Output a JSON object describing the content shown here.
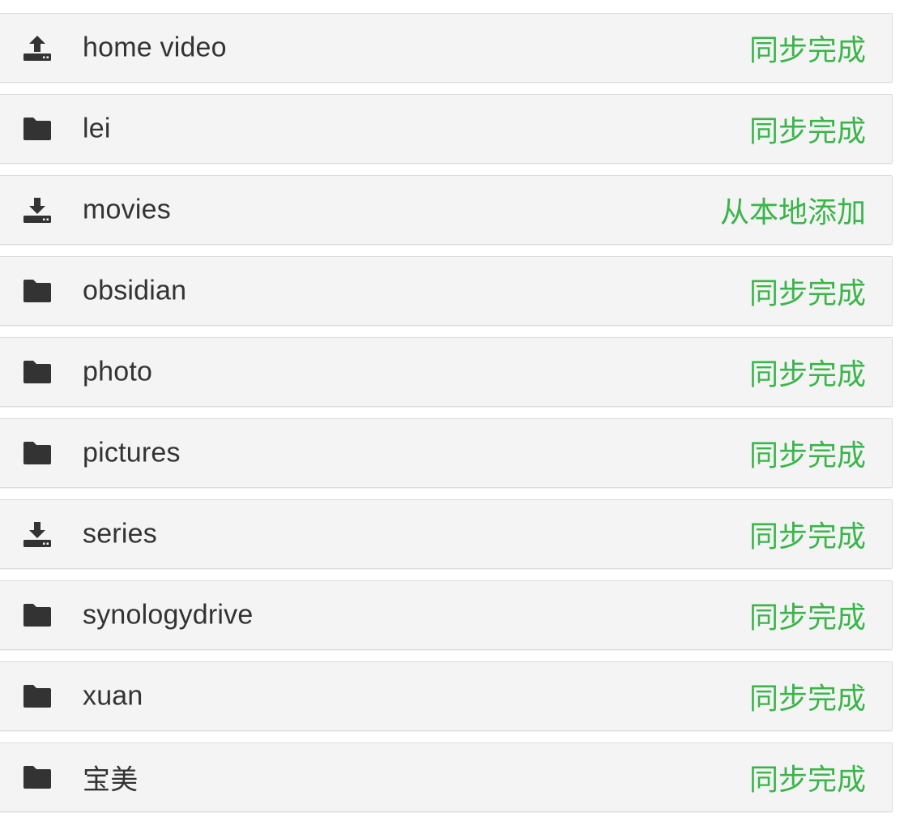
{
  "colors": {
    "status_green": "#3ab54a",
    "text_dark": "#333333",
    "row_bg": "#f4f4f4",
    "row_border": "#dcdcdc"
  },
  "folders": [
    {
      "name": "home video",
      "status": "同步完成",
      "icon": "upload-icon"
    },
    {
      "name": "lei",
      "status": "同步完成",
      "icon": "folder-icon"
    },
    {
      "name": "movies",
      "status": "从本地添加",
      "icon": "download-icon"
    },
    {
      "name": "obsidian",
      "status": "同步完成",
      "icon": "folder-icon"
    },
    {
      "name": "photo",
      "status": "同步完成",
      "icon": "folder-icon"
    },
    {
      "name": "pictures",
      "status": "同步完成",
      "icon": "folder-icon"
    },
    {
      "name": "series",
      "status": "同步完成",
      "icon": "download-icon"
    },
    {
      "name": "synologydrive",
      "status": "同步完成",
      "icon": "folder-icon"
    },
    {
      "name": "xuan",
      "status": "同步完成",
      "icon": "folder-icon"
    },
    {
      "name": "宝美",
      "status": "同步完成",
      "icon": "folder-icon"
    }
  ]
}
